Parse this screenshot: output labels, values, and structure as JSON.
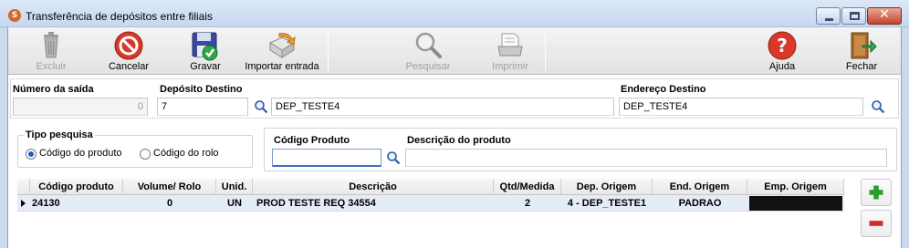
{
  "window": {
    "title": "Transferência de depósitos entre filiais",
    "app_icon_letter": "S"
  },
  "toolbar": {
    "excluir": "Excluir",
    "cancelar": "Cancelar",
    "gravar": "Gravar",
    "importar": "Importar entrada",
    "pesquisar": "Pesquisar",
    "imprimir": "Imprimir",
    "ajuda": "Ajuda",
    "fechar": "Fechar"
  },
  "header_form": {
    "numero_saida_label": "Número da saída",
    "numero_saida_value": "0",
    "deposito_destino_label": "Depósito Destino",
    "deposito_destino_code": "7",
    "deposito_destino_name": "DEP_TESTE4",
    "endereco_destino_label": "Endereço Destino",
    "endereco_destino_value": "DEP_TESTE4"
  },
  "tipo_pesquisa": {
    "title": "Tipo pesquisa",
    "option_produto": "Código do produto",
    "option_rolo": "Código do rolo",
    "selected": "produto"
  },
  "search": {
    "codigo_produto_label": "Código Produto",
    "codigo_produto_value": "",
    "descricao_label": "Descrição do produto",
    "descricao_value": ""
  },
  "grid": {
    "columns": [
      "Código produto",
      "Volume/ Rolo",
      "Unid.",
      "Descrição",
      "Qtd/Medida",
      "Dep. Origem",
      "End. Origem",
      "Emp. Origem"
    ],
    "rows": [
      {
        "codigo": "24130",
        "volume": "0",
        "unid": "UN",
        "descricao": "PROD TESTE REQ 34554",
        "qtd": "2",
        "dep_origem": "4 - DEP_TESTE1",
        "end_origem": "PADRAO",
        "emp_origem": ""
      }
    ]
  },
  "colors": {
    "title_bg": "#c6d8ef",
    "selected_row": "#e4ecf8",
    "close_red": "#c4432a",
    "add_green": "#2f9a2f",
    "remove_red": "#d02a2a"
  }
}
